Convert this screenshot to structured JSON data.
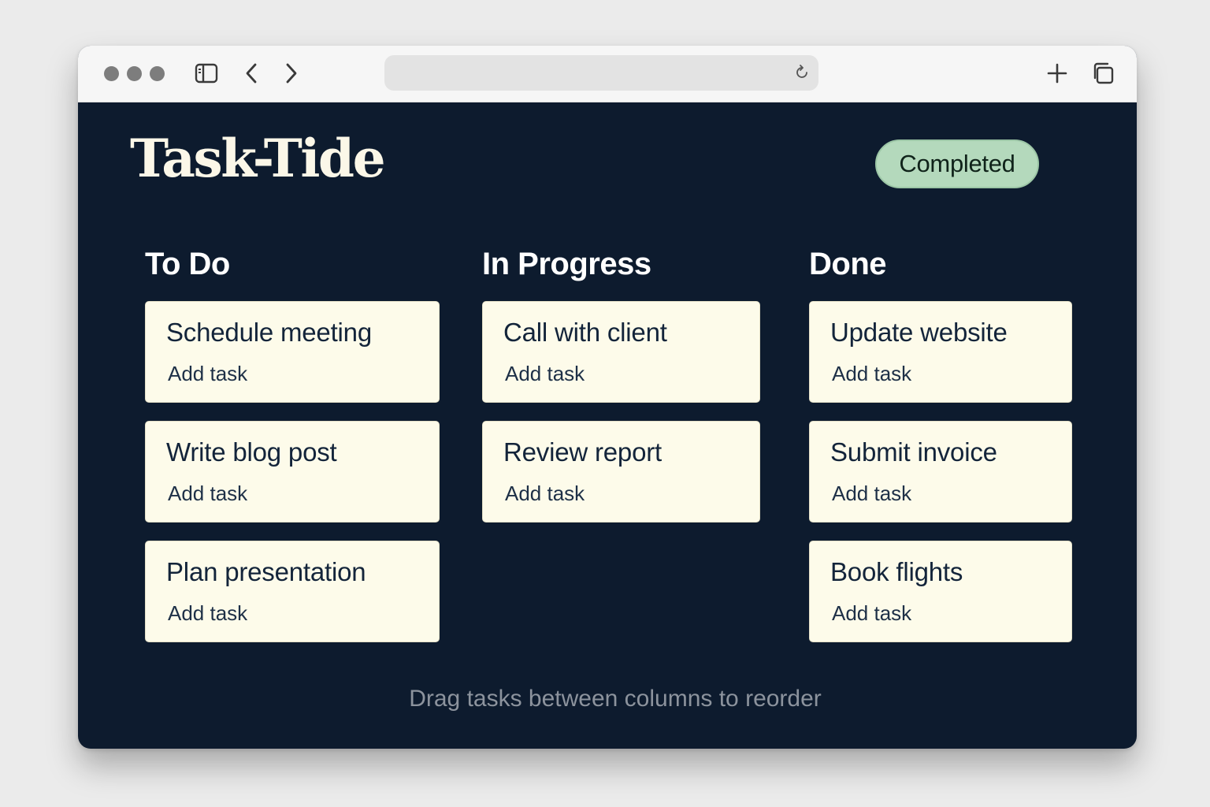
{
  "browser": {
    "traffic_light_color": "#7d7d7d",
    "url_value": "",
    "icons": {
      "sidebar": "sidebar-toggle-icon",
      "back": "chevron-left-icon",
      "forward": "chevron-right-icon",
      "reload": "reload-icon",
      "new_tab": "plus-icon",
      "tabs": "tab-overview-icon"
    }
  },
  "app": {
    "title": "Task-Tide",
    "status_badge": "Completed",
    "footer_hint": "Drag tasks between columns to reorder",
    "colors": {
      "background": "#0d1b2e",
      "card": "#fdfbea",
      "badge": "#b4d9bc",
      "title": "#fbf7e8"
    }
  },
  "columns": [
    {
      "title": "To Do",
      "cards": [
        {
          "title": "Schedule meeting",
          "action": "Add task"
        },
        {
          "title": "Write blog post",
          "action": "Add task"
        },
        {
          "title": "Plan presentation",
          "action": "Add task"
        }
      ]
    },
    {
      "title": "In Progress",
      "cards": [
        {
          "title": "Call with client",
          "action": "Add task"
        },
        {
          "title": "Review report",
          "action": "Add task"
        }
      ]
    },
    {
      "title": "Done",
      "cards": [
        {
          "title": "Update website",
          "action": "Add task"
        },
        {
          "title": "Submit invoice",
          "action": "Add task"
        },
        {
          "title": "Book flights",
          "action": "Add task"
        }
      ]
    }
  ]
}
